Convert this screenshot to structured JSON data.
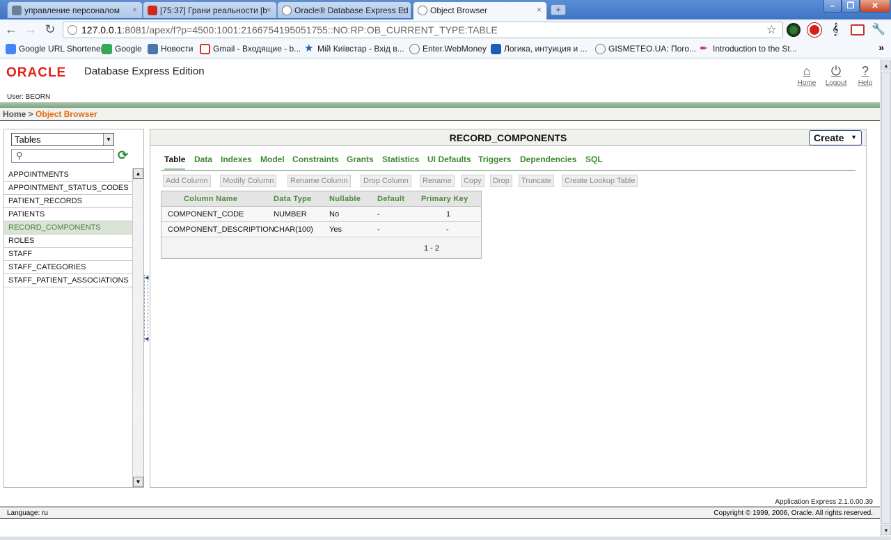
{
  "browser": {
    "tabs": [
      {
        "title": "управление персоналом",
        "icon_color": "#6a7f9a"
      },
      {
        "title": "[75:37] Грани реальности [b",
        "icon_color": "#d02a1a"
      },
      {
        "title": "Oracle® Database Express Ed",
        "icon_color": "#888888"
      },
      {
        "title": "Object Browser",
        "icon_color": "#888888"
      }
    ],
    "close_glyph": "×",
    "new_tab_glyph": "+",
    "window_controls": {
      "minimize": "–",
      "maximize": "❐",
      "close": "✕"
    },
    "url": {
      "host": "127.0.0.1",
      "rest": ":8081/apex/f?p=4500:1001:2166754195051755::NO:RP:OB_CURRENT_TYPE:TABLE"
    },
    "bookmarks": [
      "Google URL Shortener",
      "Google",
      "Новости",
      "Gmail - Входящие - b...",
      "Мій Київстар - Вхід в...",
      "Enter.WebMoney",
      "Логика, интуиция и ...",
      "GISMETEO.UA: Пого...",
      "Introduction to the St..."
    ],
    "bookmarks_overflow": "»"
  },
  "header": {
    "logo": "ORACLE",
    "product": "Database Express Edition",
    "user": "User: BEORN",
    "links": {
      "home": "Home",
      "logout": "Logout",
      "help": "Help"
    }
  },
  "breadcrumb": {
    "home": "Home",
    "separator": " > ",
    "current": "Object Browser"
  },
  "sidebar": {
    "type_select": "Tables",
    "search_value": "",
    "objects": [
      "APPOINTMENTS",
      "APPOINTMENT_STATUS_CODES",
      "PATIENT_RECORDS",
      "PATIENTS",
      "RECORD_COMPONENTS",
      "ROLES",
      "STAFF",
      "STAFF_CATEGORIES",
      "STAFF_PATIENT_ASSOCIATIONS"
    ],
    "selected": "RECORD_COMPONENTS"
  },
  "main": {
    "title": "RECORD_COMPONENTS",
    "create_label": "Create",
    "tabs": [
      "Table",
      "Data",
      "Indexes",
      "Model",
      "Constraints",
      "Grants",
      "Statistics",
      "UI Defaults",
      "Triggers",
      "Dependencies",
      "SQL"
    ],
    "active_tab": "Table",
    "actions": [
      "Add Column",
      "Modify Column",
      "Rename Column",
      "Drop Column",
      "Rename",
      "Copy",
      "Drop",
      "Truncate",
      "Create Lookup Table"
    ],
    "columns_table": {
      "headers": [
        "Column Name",
        "Data Type",
        "Nullable",
        "Default",
        "Primary Key"
      ],
      "rows": [
        [
          "COMPONENT_CODE",
          "NUMBER",
          "No",
          "-",
          "1"
        ],
        [
          "COMPONENT_DESCRIPTION",
          "CHAR(100)",
          "Yes",
          "-",
          "-"
        ]
      ],
      "pagination": "1 - 2"
    }
  },
  "footer": {
    "version": "Application Express 2.1.0.00.39",
    "language": "Language: ru",
    "copyright": "Copyright © 1999, 2006, Oracle. All rights reserved."
  },
  "colors": {
    "oracle_red": "#e2231a",
    "link_green": "#3c8a2e",
    "crumb_orange": "#e06b14",
    "band_green": "#a9c4ad"
  }
}
